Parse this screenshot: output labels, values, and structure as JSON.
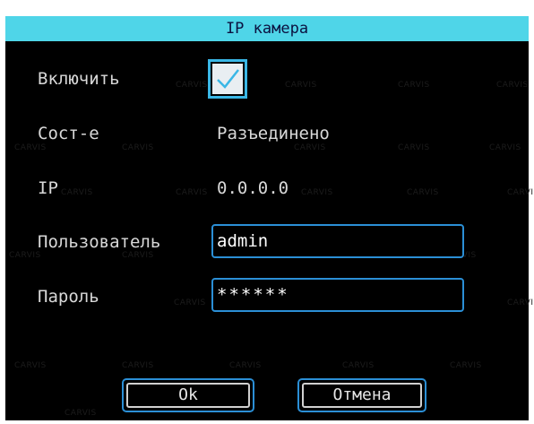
{
  "title": "IP камера",
  "watermark": "CARVIS",
  "enable": {
    "label": "Включить",
    "checked": true
  },
  "status": {
    "label": "Сост-е",
    "value": "Разъединено"
  },
  "ip": {
    "label": "IP",
    "value": "0.0.0.0"
  },
  "user": {
    "label": "Пользователь",
    "value": "admin"
  },
  "password": {
    "label": "Пароль",
    "value": "******"
  },
  "buttons": {
    "ok": "Ok",
    "cancel": "Отмена"
  },
  "colors": {
    "title_bg": "#4fd5e8",
    "accent_border": "#2b8fd6",
    "dialog_bg": "#000000"
  }
}
